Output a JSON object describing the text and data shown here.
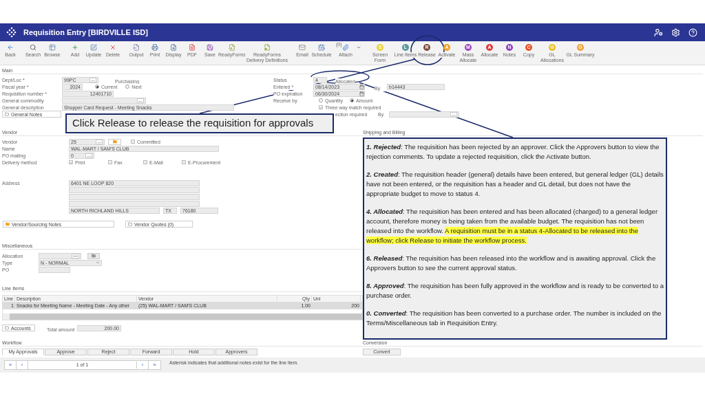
{
  "window": {
    "title": "Requisition Entry [BIRDVILLE ISD]"
  },
  "toolbar": [
    {
      "kind": "icon",
      "label": "Back",
      "dropdown": false
    },
    {
      "kind": "icon",
      "label": "Search"
    },
    {
      "kind": "icon",
      "label": "Browse"
    },
    {
      "kind": "icon",
      "label": "Add"
    },
    {
      "kind": "icon",
      "label": "Update"
    },
    {
      "kind": "icon",
      "label": "Delete"
    },
    {
      "kind": "icon",
      "label": "Output"
    },
    {
      "kind": "icon",
      "label": "Print"
    },
    {
      "kind": "icon",
      "label": "Display"
    },
    {
      "kind": "icon",
      "label": "PDF"
    },
    {
      "kind": "icon",
      "label": "Save"
    },
    {
      "kind": "icon",
      "label": "ReadyForms"
    },
    {
      "kind": "icon",
      "label": "ReadyForms Delivery Definitions"
    },
    {
      "kind": "icon",
      "label": "Email"
    },
    {
      "kind": "icon",
      "label": "Schedule"
    },
    {
      "kind": "icon",
      "label": "Attach",
      "badge": "(0)",
      "dropdown": true
    },
    {
      "kind": "letter",
      "letter": "S",
      "color": "#e8d33a",
      "label": "Screen Form"
    },
    {
      "kind": "letter",
      "letter": "L",
      "color": "#5a9aa0",
      "label": "Line Items"
    },
    {
      "kind": "letter",
      "letter": "R",
      "color": "#7a4a3a",
      "label": "Release"
    },
    {
      "kind": "letter",
      "letter": "A",
      "color": "#f0a020",
      "label": "Activate"
    },
    {
      "kind": "letter",
      "letter": "M",
      "color": "#a040c0",
      "label": "Mass Allocate"
    },
    {
      "kind": "letter",
      "letter": "A",
      "color": "#e03a3a",
      "label": "Allocate"
    },
    {
      "kind": "letter",
      "letter": "N",
      "color": "#9040c0",
      "label": "Notes"
    },
    {
      "kind": "letter",
      "letter": "C",
      "color": "#e85020",
      "label": "Copy"
    },
    {
      "kind": "letter",
      "letter": "G",
      "color": "#e8c020",
      "label": "GL Allocations"
    },
    {
      "kind": "letter",
      "letter": "G",
      "color": "#f0a030",
      "label": "GL Summary"
    }
  ],
  "main": {
    "heading": "Main",
    "dept_loc": {
      "label": "Dept/Loc *",
      "value": "99PC",
      "button": "...",
      "extra": "Purchasing"
    },
    "fiscal_year": {
      "label": "Fiscal year *",
      "value": "2024",
      "options": [
        {
          "label": "Current",
          "selected": true
        },
        {
          "label": "Next",
          "selected": false
        }
      ]
    },
    "requisition_number": {
      "label": "Requisition number *",
      "value": "12401710"
    },
    "general_commodity": {
      "label": "General commodity",
      "button": "..."
    },
    "general_description": {
      "label": "General description",
      "value": "Shopper Card Request - Meeting Snacks"
    },
    "general_notes": "General Notes",
    "status": {
      "label": "Status",
      "code": "4",
      "value": "Allocated"
    },
    "entered": {
      "label": "Entered *",
      "value": "08/14/2023",
      "by_label": "By",
      "by": "b14443"
    },
    "po_expiration": {
      "label": "PO expiration",
      "value": "06/30/2024"
    },
    "receive_by": {
      "label": "Receive by",
      "options": [
        {
          "label": "Quantity",
          "selected": false
        },
        {
          "label": "Amount",
          "selected": true
        }
      ]
    },
    "three_way_match": {
      "label": "Three way match required",
      "checked": true
    },
    "inspection": {
      "label": "ection required",
      "by_label": "By",
      "button": "..."
    }
  },
  "vendor": {
    "heading": "Vendor",
    "shipping_heading": "Shipping and Billing",
    "vendor": {
      "label": "Vendor",
      "value": "25",
      "button": "..."
    },
    "committed": {
      "label": "Committed",
      "checked": false
    },
    "name": {
      "label": "Name",
      "value": "WAL-MART / SAM'S CLUB"
    },
    "po_mailing": {
      "label": "PO mailing",
      "value": "0",
      "button": "..."
    },
    "delivery": {
      "label": "Delivery method",
      "options": [
        {
          "label": "Print",
          "checked": true
        },
        {
          "label": "Fax",
          "checked": false
        },
        {
          "label": "E-Mail",
          "checked": false
        },
        {
          "label": "E-Procurement",
          "checked": false
        }
      ]
    },
    "address": {
      "label": "Address",
      "line_1": "6401 NE LOOP 820",
      "city": "NORTH RICHLAND HILLS",
      "state": "TX",
      "zip": "76180"
    },
    "notes_buttons": [
      "Vendor/Sourcing Notes",
      "Vendor Quotes (0)"
    ]
  },
  "miscellaneous": {
    "heading": "Miscellaneous",
    "allocation": {
      "label": "Allocation",
      "button": "—"
    },
    "type": {
      "label": "Type",
      "value": "N - NORMAL"
    },
    "po": {
      "label": "PO"
    }
  },
  "line_items": {
    "heading": "Line Items",
    "columns": [
      "Line",
      "Description",
      "Vendor",
      "Qty",
      "Uni"
    ],
    "rows": [
      {
        "cells": [
          "1",
          "Snacks for Meeting Name - Meeting Date - Any other",
          "(25) WAL-MART / SAM'S CLUB",
          "1.00",
          "200"
        ],
        "selected": true
      }
    ],
    "accounts": "Accounts",
    "total": {
      "label": "Total amount",
      "value": "200.00"
    }
  },
  "workflow": {
    "heading": "Workflow",
    "tabs": [
      {
        "label": "My Approvals",
        "selected": true
      },
      {
        "label": "Approve",
        "selected": false
      },
      {
        "label": "Reject",
        "selected": false
      },
      {
        "label": "Forward",
        "selected": false
      },
      {
        "label": "Hold",
        "selected": false
      },
      {
        "label": "Approvers",
        "selected": false
      }
    ]
  },
  "conversion": {
    "heading": "Conversion",
    "button": "Convert"
  },
  "pager": {
    "first": "«",
    "prev": "‹",
    "page": "1 of 1",
    "next": "›",
    "last": "»",
    "note": "Asterisk indicates that additional notes exist for the line item."
  },
  "callout": "Click Release to release the requisition for approvals",
  "status_descriptions": [
    {
      "term": "1. Rejected",
      "text": ": The requisition has been rejected by an approver. Click the Approvers button to view the rejection comments. To update a rejected requisition, click the Activate button."
    },
    {
      "term": "2. Created",
      "text": ": The requisition header (general) details have been entered, but general ledger (GL) details have not been entered, or the requisition has a header and GL detail, but does not have the appropriate budget to move to status 4."
    },
    {
      "term": "4. Allocated",
      "text": ": The requisition has been entered and has been allocated (charged) to a general ledger account, therefore money is being taken from the available budget. The requisition has not been released into the workflow. ",
      "highlight": "A requisition must be in a status 4-Allocated to be released into the workflow; click Release to initiate the workflow process."
    },
    {
      "term": "6. Released",
      "text": ": The requisition has been released into the workflow and is awaiting approval. Click the Approvers button to see the current approval status."
    },
    {
      "term": "8. Approved",
      "text": ": The requisition has been fully approved in the workflow and is ready to be converted to a purchase order."
    },
    {
      "term": "0. Converted",
      "text": ": The requisition has been converted to a purchase order. The number is included on the Terms/Miscellaneous tab in Requisition Entry."
    }
  ]
}
